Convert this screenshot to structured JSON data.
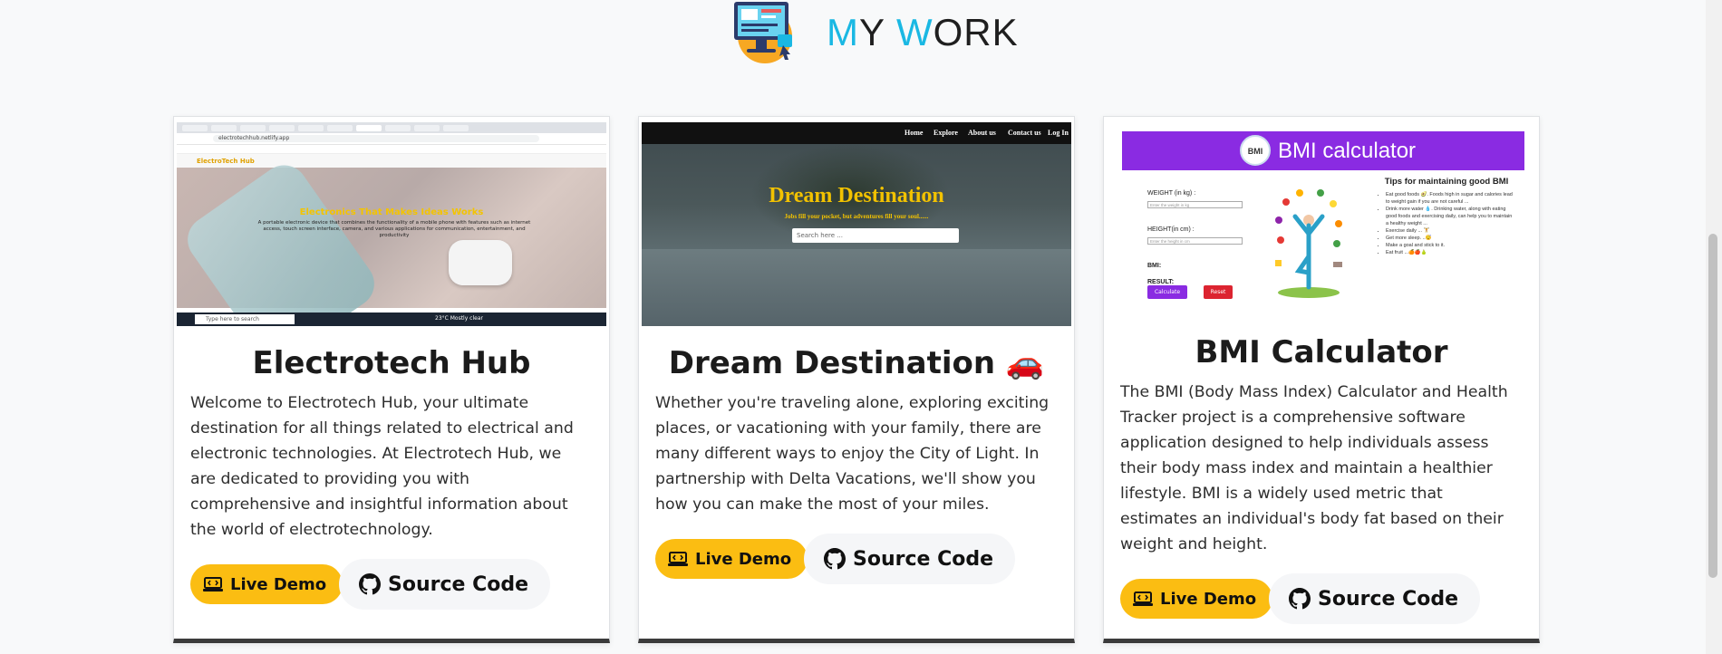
{
  "header": {
    "title_part1_accent": "M",
    "title_part2": "Y ",
    "title_part3_accent": "W",
    "title_part4": "ORK",
    "logo_icon": "computer-monitor-icon"
  },
  "colors": {
    "accent_blue": "#1ab8e3",
    "demo_button": "#fbbd12",
    "source_button_bg": "#f5f6f8",
    "card_bottom_border": "#3b3b3b"
  },
  "projects": [
    {
      "title": "Electrotech Hub",
      "emoji": "",
      "description": "Welcome to Electrotech Hub, your ultimate destination for all things related to electrical and electronic technologies. At Electrotech Hub, we are dedicated to providing you with comprehensive and insightful information about the world of electrotechnology.",
      "demo_label": "Live Demo",
      "source_label": "Source Code",
      "thumb": {
        "url": "electrotechhub.netlify.app",
        "brand": "ElectroTech Hub",
        "hero_title": "Electronics That Makes Ideas Works",
        "hero_text": "A portable electronic device that combines the functionality of a mobile phone with features such as internet access, touch screen interface, camera, and various applications for communication, entertainment, and productivity",
        "taskbar_search": "Type here to search",
        "weather": "23°C Mostly clear"
      }
    },
    {
      "title": "Dream Destination",
      "emoji": "🚗",
      "description": "Whether you're traveling alone, exploring exciting places, or vacationing with your family, there are many different ways to enjoy the City of Light. In partnership with Delta Vacations, we'll show you how you can make the most of your miles.",
      "demo_label": "Live Demo",
      "source_label": "Source Code",
      "thumb": {
        "nav": [
          "Home",
          "Explore",
          "About us",
          "Contact us",
          "Log In"
        ],
        "hero_title": "Dream Destination",
        "hero_sub": "Jobs fill your pocket, but adventures fill your soul......",
        "search_placeholder": "Search here ..."
      }
    },
    {
      "title": "BMI Calculator",
      "emoji": "",
      "description": "The BMI (Body Mass Index) Calculator and Health Tracker project is a comprehensive software application designed to help individuals assess their body mass index and maintain a healthier lifestyle. BMI is a widely used metric that estimates an individual's body fat based on their weight and height.",
      "demo_label": "Live Demo",
      "source_label": "Source Code",
      "thumb": {
        "bar_title": "BMI calculator",
        "gauge_label": "BMI",
        "weight_label": "WEIGHT (in kg) :",
        "weight_placeholder": "Enter the weight in kg",
        "height_label": "HEIGHT(in cm) :",
        "height_placeholder": "Enter the height in cm",
        "bmi_label": "BMI:",
        "result_label": "RESULT:",
        "calculate": "Calculate",
        "reset": "Reset",
        "tips_title": "Tips for maintaining good BMI",
        "tips": [
          "Eat good foods 🥑. Foods high in sugar and calories lead to weight gain if you are not careful ...",
          "Drink more water 💧. Drinking water, along with eating good foods and exercising daily, can help you to maintain a healthy weight ...",
          "Exercise daily ... 🏋",
          "Get more sleep. ..😴",
          "Make a goal and stick to it.",
          "Eat fruit ...🍊🍎🍐"
        ]
      }
    }
  ]
}
